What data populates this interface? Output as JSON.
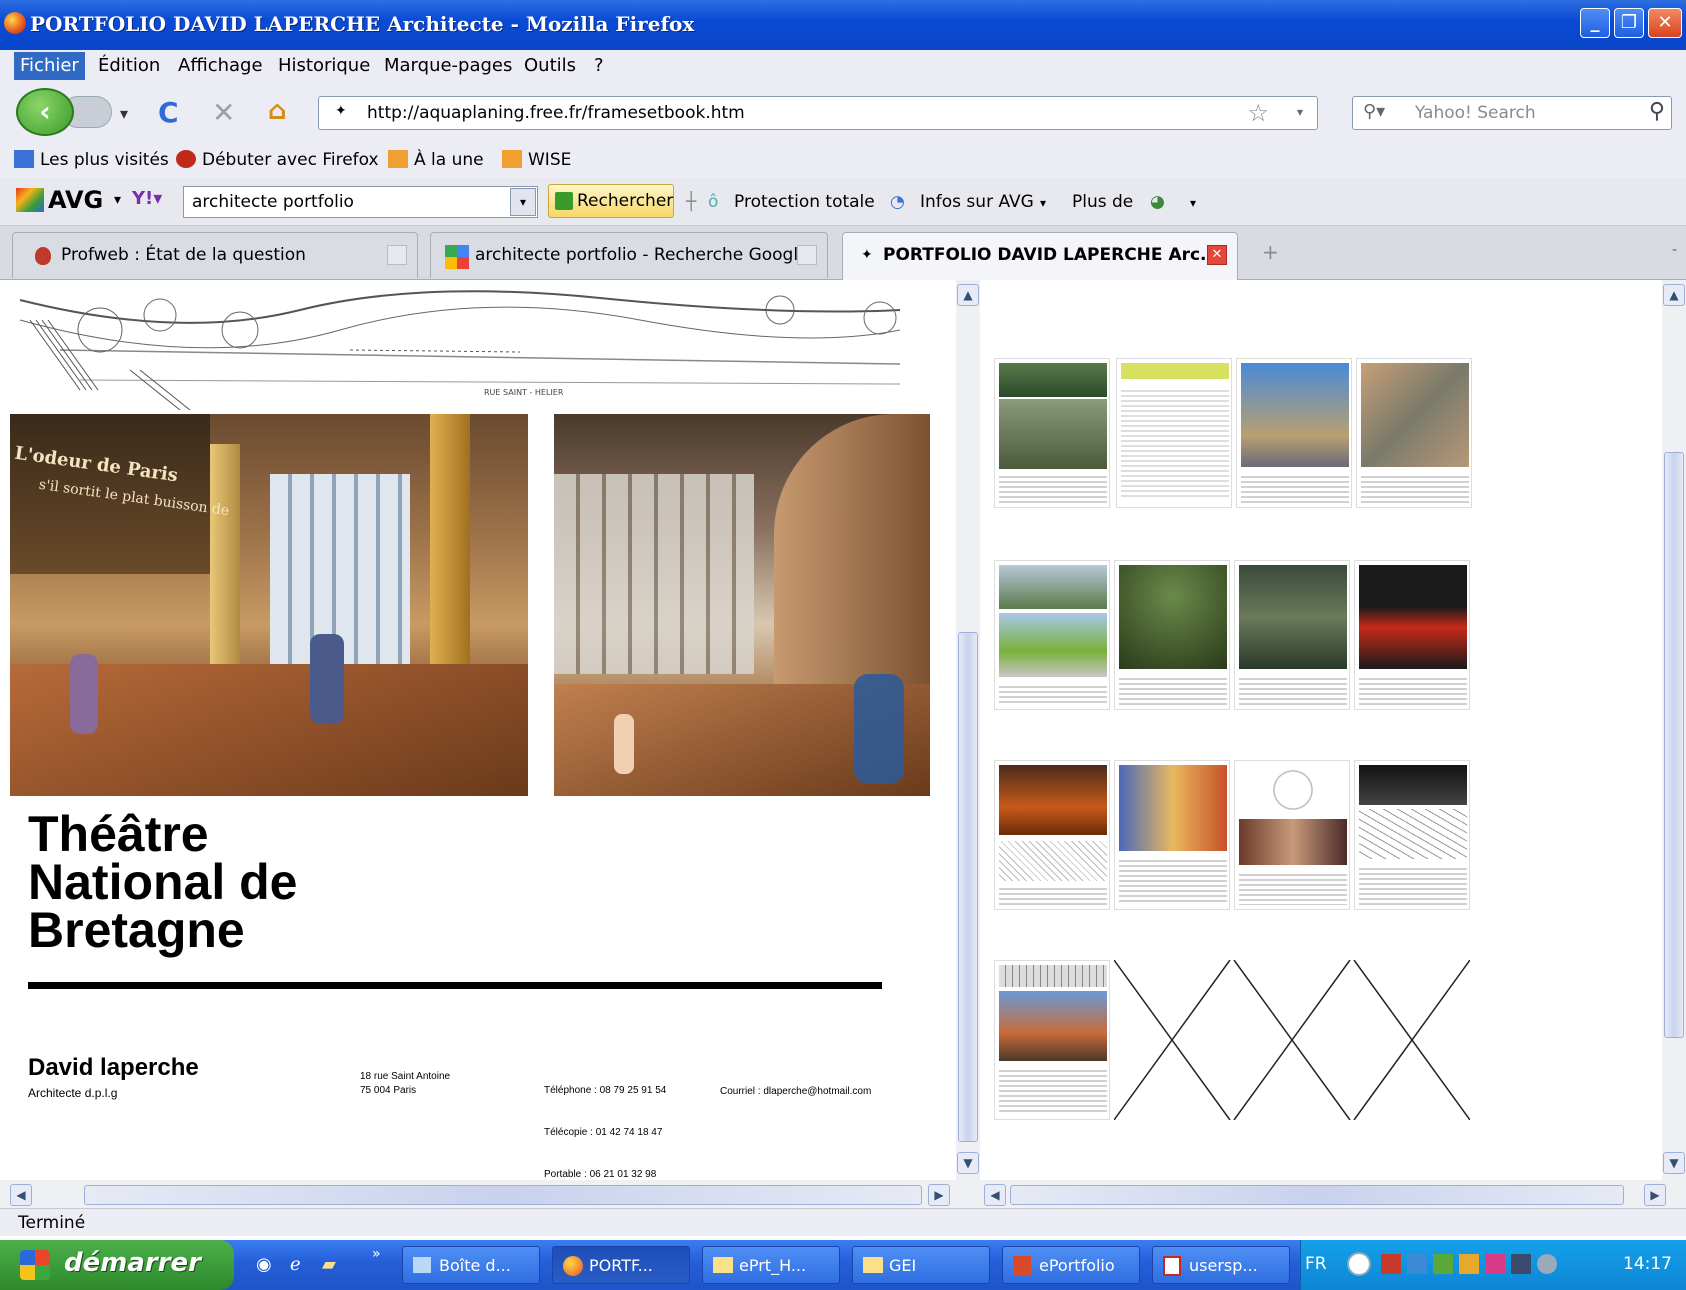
{
  "window": {
    "title": "PORTFOLIO DAVID LAPERCHE Architecte - Mozilla Firefox"
  },
  "menu": [
    "Fichier",
    "Édition",
    "Affichage",
    "Historique",
    "Marque-pages",
    "Outils",
    "?"
  ],
  "nav": {
    "url": "http://aquaplaning.free.fr/framesetbook.htm",
    "search_placeholder": "Yahoo! Search"
  },
  "bookmarks": [
    "Les plus visités",
    "Débuter avec Firefox",
    "À la une",
    "WISE"
  ],
  "avg": {
    "logo": "AVG",
    "query": "architecte portfolio",
    "search_button": "Rechercher",
    "protection": "Protection totale",
    "infos": "Infos sur AVG",
    "more": "Plus de"
  },
  "tabs": [
    {
      "label": "Profweb : État de la question",
      "active": false
    },
    {
      "label": "architecte portfolio - Recherche Google",
      "active": false
    },
    {
      "label": "PORTFOLIO DAVID LAPERCHE Arc...",
      "active": true
    }
  ],
  "page": {
    "street_label": "RUE SAINT - HELIER",
    "title_lines": [
      "Théâtre",
      "National de",
      "Bretagne"
    ],
    "author_name": "David laperche",
    "author_role": "Architecte d.p.l.g",
    "address_lines": [
      "18 rue Saint Antoine",
      "75 004 Paris"
    ],
    "phones": [
      "Téléphone : 08 79 25 91 54",
      "Télécopie : 01 42 74 18 47",
      "Portable : 06 21 01 32 98"
    ],
    "email": "Courriel : dlaperche@hotmail.com",
    "overlay_text": [
      "L'odeur de Paris",
      "s'il sortit le plat buisson de"
    ]
  },
  "status": {
    "text": "Terminé"
  },
  "taskbar": {
    "start": "démarrer",
    "items": [
      "Boîte d...",
      "PORTF...",
      "ePrt_H...",
      "GEI",
      "ePortfolio",
      "usersp..."
    ],
    "lang": "FR",
    "clock": "14:17"
  }
}
